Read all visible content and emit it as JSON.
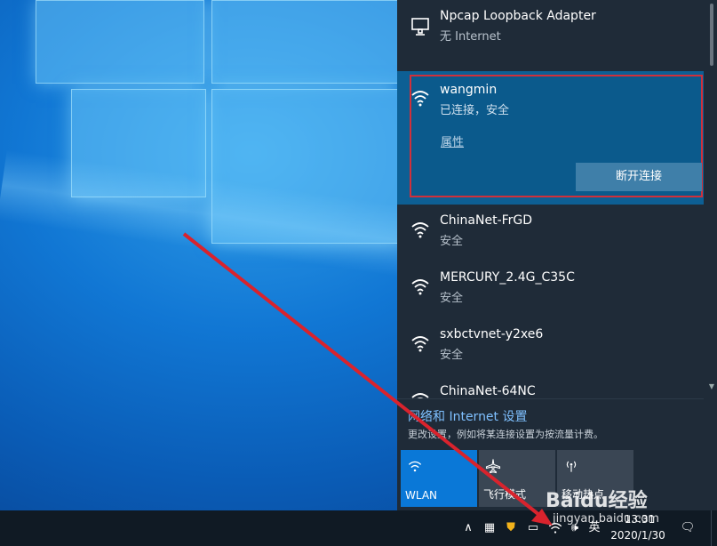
{
  "networks": [
    {
      "name": "Npcap Loopback Adapter",
      "status": "无 Internet",
      "icon": "ethernet-icon"
    },
    {
      "name": "wangmin",
      "status": "已连接，安全",
      "icon": "wifi-icon",
      "properties_label": "属性",
      "disconnect_label": "断开连接"
    },
    {
      "name": "ChinaNet-FrGD",
      "status": "安全",
      "icon": "wifi-icon"
    },
    {
      "name": "MERCURY_2.4G_C35C",
      "status": "安全",
      "icon": "wifi-icon"
    },
    {
      "name": "sxbctvnet-y2xe6",
      "status": "安全",
      "icon": "wifi-icon"
    },
    {
      "name": "ChinaNet-64NC",
      "status": "",
      "icon": "wifi-icon"
    }
  ],
  "settings": {
    "title": "网络和 Internet 设置",
    "description": "更改设置，例如将某连接设置为按流量计费。"
  },
  "tiles": [
    {
      "label": "WLAN",
      "icon": "wifi-icon",
      "active": true
    },
    {
      "label": "飞行模式",
      "icon": "airplane-icon",
      "active": false
    },
    {
      "label": "移动热点",
      "icon": "hotspot-icon",
      "active": false
    }
  ],
  "taskbar": {
    "language": "英",
    "time": "13:31",
    "date": "2020/1/30"
  },
  "watermark": {
    "brand": "Baidu经验",
    "site": "jingyan.baidu.com"
  },
  "colors": {
    "accent": "#0a78d7",
    "highlight_border": "#d0303a",
    "flyout_bg": "#1f2b38",
    "arrow": "#d9232d"
  }
}
